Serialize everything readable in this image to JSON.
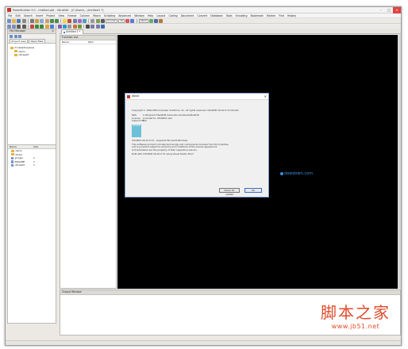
{
  "window": {
    "title": "PowerBuilder 9.0 - Untitled.pbt - UltraEdit - [C:\\Users\\...\\Untitled1 *]"
  },
  "menu": [
    "File",
    "Edit",
    "Search",
    "Insert",
    "Project",
    "View",
    "Format",
    "Column",
    "Macro",
    "Scripting",
    "Advanced",
    "Window",
    "Help",
    "Layout",
    "Coding",
    "Document",
    "Convert",
    "Database",
    "Tools",
    "Encoding",
    "Bookmark",
    "Marker",
    "Find",
    "History"
  ],
  "toolbar": {
    "font_select": "Courier",
    "size_select": "10",
    "encoding_select": "ASCII"
  },
  "file_manager": {
    "title": "File Manager",
    "tabs": [
      "Project view",
      "Open Files"
    ],
    "tree": [
      {
        "label": "D:\\desktop\\www"
      },
      {
        "label": "demo"
      },
      {
        "label": "ultraedit"
      }
    ],
    "list_header": [
      "Name",
      "Size"
    ],
    "files": [
      {
        "name": "demo",
        "size": ""
      },
      {
        "name": "folder",
        "size": ""
      },
      {
        "name": "google",
        "size": "1"
      },
      {
        "name": "README",
        "size": "1"
      },
      {
        "name": "ultraedit",
        "size": "1"
      }
    ]
  },
  "function_list": {
    "title": "Function List",
    "header": [
      "Name",
      "Path"
    ]
  },
  "document_tab": {
    "label": "Untitled 1 *"
  },
  "watermark": "dawdown.com",
  "output_window": {
    "title": "Output Window"
  },
  "about_dialog": {
    "title": "About",
    "copyright": "Copyright © 1991 IDM Computer Solutions, Inc.   All rights reserved.   UltraEdit 26.10.0.72 (64-bit)",
    "rows": [
      {
        "key": "Path",
        "value": "C:\\Program Files\\IDM Computer Solutions\\UltraEdit"
      },
      {
        "key": "License",
        "value": "Licensed to: UltraEdit user"
      },
      {
        "key": "Support ID",
        "value": "N/A"
      }
    ],
    "logo_text": "UltraEdit",
    "notice_lines": [
      "UltraEdit 26.10.0.72 - supports Microsoft Windows",
      "This software product includes technology and components licensed from third parties,",
      "and is provided subject to all terms and conditions of the license agreement.",
      "All trademarks are the property of their respective owners.",
      "Built with UltraEdit 26.10.0.72 using Visual Studio 2017"
    ],
    "buttons": {
      "left": "Check for update",
      "ok": "OK"
    }
  },
  "site_watermark": {
    "zh": "脚本之家",
    "url": "www.jb51.net"
  },
  "colors": {
    "accent": "#4a7fd0",
    "editor_bg": "#000000",
    "watermark": "#3c8fe0",
    "brand_red": "#e04a2a"
  }
}
